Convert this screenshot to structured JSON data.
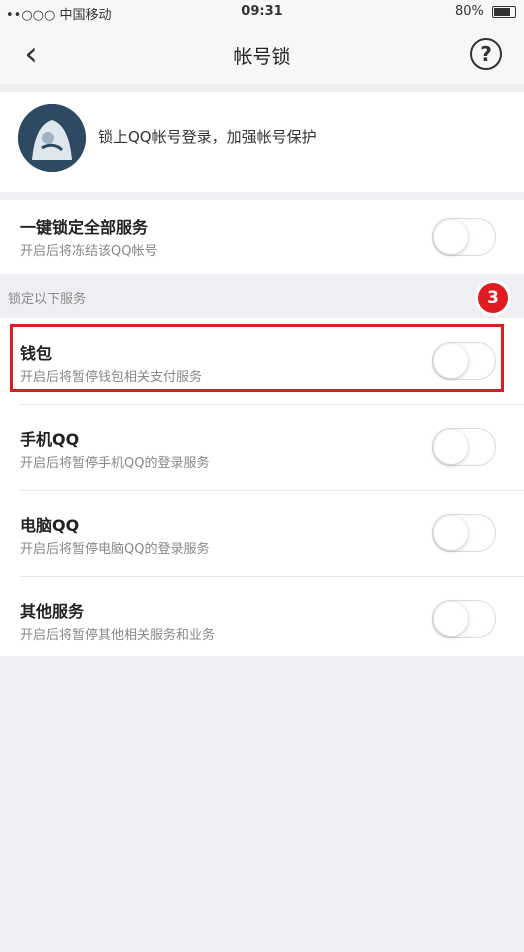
{
  "status_bar": {
    "carrier": "••○○○ 中国移动",
    "time": "09:31",
    "battery": "80%"
  },
  "nav": {
    "back_icon": "‹",
    "title": "帐号锁",
    "help_icon": "?"
  },
  "account": {
    "text": "锁上QQ帐号登录，加强帐号保护"
  },
  "lock_all": {
    "title": "一键锁定全部服务",
    "desc": "开启后将冻结该QQ帐号"
  },
  "section_label": "锁定以下服务",
  "annotation": "3",
  "rows": [
    {
      "title": "钱包",
      "desc": "开启后将暂停钱包相关支付服务"
    },
    {
      "title": "手机QQ",
      "desc": "开启后将暂停手机QQ的登录服务"
    },
    {
      "title": "电脑QQ",
      "desc": "开启后将暂停电脑QQ的登录服务"
    },
    {
      "title": "其他服务",
      "desc": "开启后将暂停其他相关服务和业务"
    }
  ],
  "toggles": [
    false,
    false,
    false,
    false,
    false
  ]
}
